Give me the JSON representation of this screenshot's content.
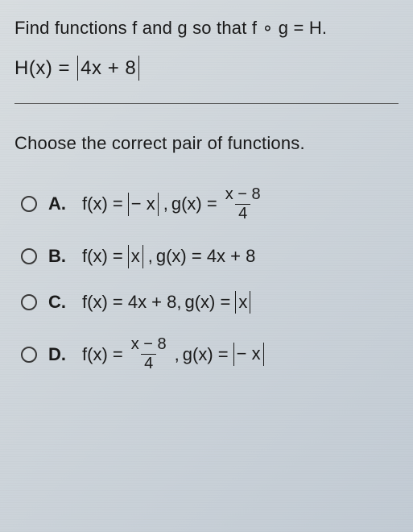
{
  "question": {
    "prompt": "Find functions f and g so that f ∘ g = H.",
    "equation_lhs": "H(x) = ",
    "equation_abs": "4x + 8"
  },
  "instruction": "Choose the correct pair of functions.",
  "options": [
    {
      "letter": "A.",
      "f_prefix": "f(x) = ",
      "f_abs": " − x",
      "comma": " ,  ",
      "g_prefix": "g(x) = ",
      "g_frac_num": "x − 8",
      "g_frac_den": "4"
    },
    {
      "letter": "B.",
      "f_prefix": "f(x) = ",
      "f_abs": "x",
      "comma": " ,  ",
      "g_prefix": "g(x) = 4x + 8"
    },
    {
      "letter": "C.",
      "f_prefix": "f(x) = 4x + 8,  ",
      "g_prefix": "g(x) = ",
      "g_abs": "x"
    },
    {
      "letter": "D.",
      "f_prefix": "f(x) = ",
      "f_frac_num": "x − 8",
      "f_frac_den": "4",
      "comma": ",  ",
      "g_prefix": "g(x) = ",
      "g_abs": " − x"
    }
  ]
}
